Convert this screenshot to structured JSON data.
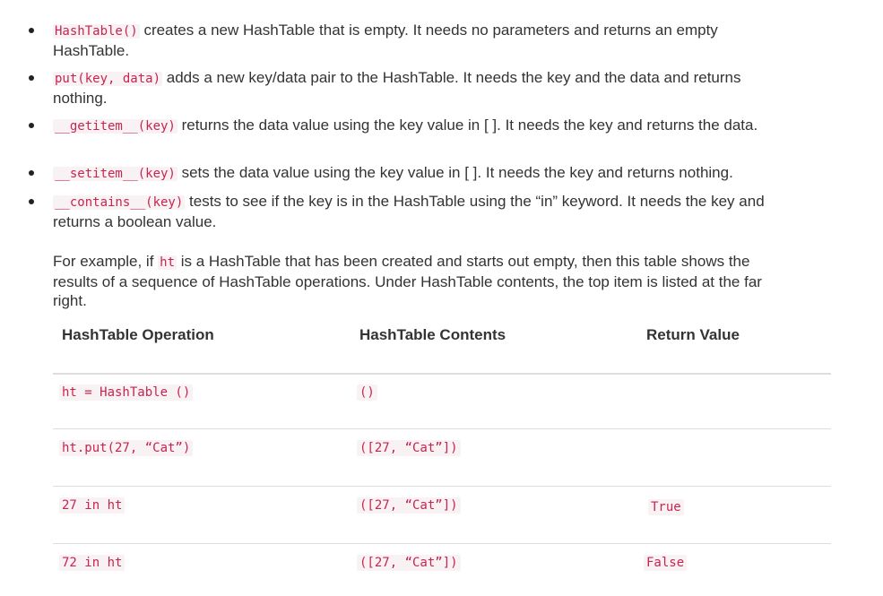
{
  "bullets": [
    {
      "code": "HashTable()",
      "text": " creates a new HashTable that is empty. It needs no parameters and returns an empty HashTable."
    },
    {
      "code": "put(key, data)",
      "text": " adds a new key/data pair to the HashTable. It needs the key and the data and returns nothing."
    },
    {
      "code": "__getitem__(key)",
      "text": " returns the data value using the key value in [ ]. It needs the key and returns the data."
    },
    {
      "code": "__setitem__(key)",
      "text": " sets the data value using the key value in [ ]. It needs the key and returns nothing."
    },
    {
      "code": "__contains__(key)",
      "text": " tests to see if the key is in the HashTable using the “in” keyword. It needs the key and returns a boolean value."
    }
  ],
  "example": {
    "pre": "For example, if ",
    "code": "ht",
    "post": " is a HashTable that has been created and starts out empty, then this table shows the results of a sequence of HashTable operations. Under HashTable contents, the top item is listed at the far right."
  },
  "table": {
    "headers": [
      "HashTable Operation",
      "HashTable Contents",
      "Return Value"
    ],
    "rows": [
      {
        "operation": "ht = HashTable ()",
        "contents": "()",
        "return": ""
      },
      {
        "operation": "ht.put(27, “Cat”)",
        "contents": "([27, “Cat”])",
        "return": ""
      },
      {
        "operation": "27 in ht",
        "contents": "([27, “Cat”])",
        "return": "True"
      },
      {
        "operation": "72 in ht",
        "contents": "([27, “Cat”])",
        "return": "False"
      }
    ]
  }
}
